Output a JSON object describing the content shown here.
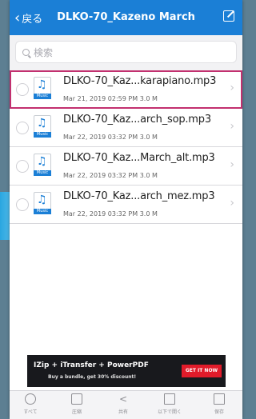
{
  "nav": {
    "back_label": "戻る",
    "title": "DLKO-70_Kazeno March"
  },
  "search": {
    "placeholder": "検索"
  },
  "files": [
    {
      "name": "DLKO-70_Kaz...karapiano.mp3",
      "date": "Mar 21, 2019 02:59 PM",
      "size": "3.0 M",
      "selected": true
    },
    {
      "name": "DLKO-70_Kaz...arch_sop.mp3",
      "date": "Mar 22, 2019 03:32 PM",
      "size": "3.0 M",
      "selected": false
    },
    {
      "name": "DLKO-70_Kaz...March_alt.mp3",
      "date": "Mar 22, 2019 03:32 PM",
      "size": "3.0 M",
      "selected": false
    },
    {
      "name": "DLKO-70_Kaz...arch_mez.mp3",
      "date": "Mar 22, 2019 03:32 PM",
      "size": "3.0 M",
      "selected": false
    }
  ],
  "file_icon_label": "Music",
  "ad": {
    "title": "IZip + iTransfer + PowerPDF",
    "subtitle": "Buy a bundle, get 30% discount!",
    "button": "GET IT NOW"
  },
  "toolbar": {
    "all": "すべて",
    "compress": "圧縮",
    "share": "共有",
    "open_in": "以下で開く",
    "save": "保存"
  },
  "colors": {
    "accent": "#1b7fd6",
    "selection": "#c2306f",
    "ad_button": "#e11b2a"
  }
}
